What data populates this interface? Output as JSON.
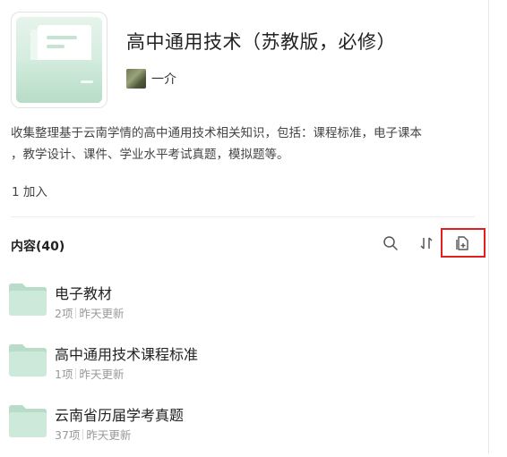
{
  "collection": {
    "title": "高中通用技术（苏教版，必修）",
    "author": "一介",
    "description_line1": "收集整理基于云南学情的高中通用技术相关知识，包括：课程标准，电子课本",
    "description_line2": "，教学设计、课件、学业水平考试真题，模拟题等。",
    "joined": "1 加入"
  },
  "content": {
    "label": "内容(40)",
    "items": [
      {
        "name": "电子教材",
        "count": "2项",
        "updated": "昨天更新"
      },
      {
        "name": "高中通用技术课程标准",
        "count": "1项",
        "updated": "昨天更新"
      },
      {
        "name": "云南省历届学考真题",
        "count": "37项",
        "updated": "昨天更新"
      }
    ]
  },
  "toolbar": {
    "icons": [
      "search-icon",
      "sort-icon",
      "add-file-icon"
    ]
  },
  "colors": {
    "accent_green": "#c6e5d3",
    "highlight_red": "#e02020",
    "meta_gray": "#999999"
  }
}
